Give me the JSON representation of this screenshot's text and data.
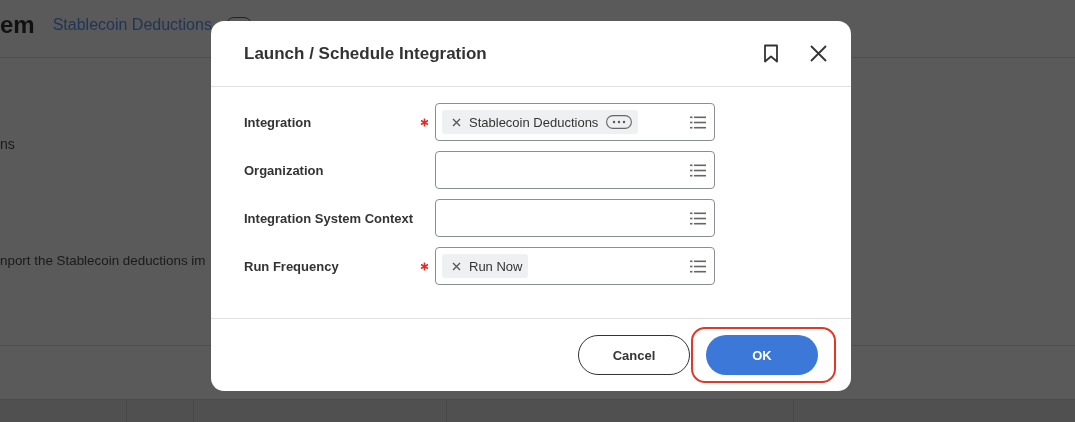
{
  "background": {
    "title_fragment": "em",
    "breadcrumb": "Stablecoin Deductions",
    "text_fragment": "ns",
    "description_fragment": "nport the Stablecoin deductions im"
  },
  "dialog": {
    "title": "Launch / Schedule Integration",
    "fields": [
      {
        "label": "Integration",
        "required": true,
        "chips": [
          {
            "text": "Stablecoin Deductions",
            "more": true
          }
        ]
      },
      {
        "label": "Organization",
        "required": false
      },
      {
        "label": "Integration System Context",
        "required": false
      },
      {
        "label": "Run Frequency",
        "required": true,
        "chips": [
          {
            "text": "Run Now",
            "more": false
          }
        ]
      }
    ],
    "buttons": [
      {
        "label": "Cancel",
        "kind": "secondary",
        "highlighted": false
      },
      {
        "label": "OK",
        "kind": "primary",
        "highlighted": true
      }
    ]
  }
}
